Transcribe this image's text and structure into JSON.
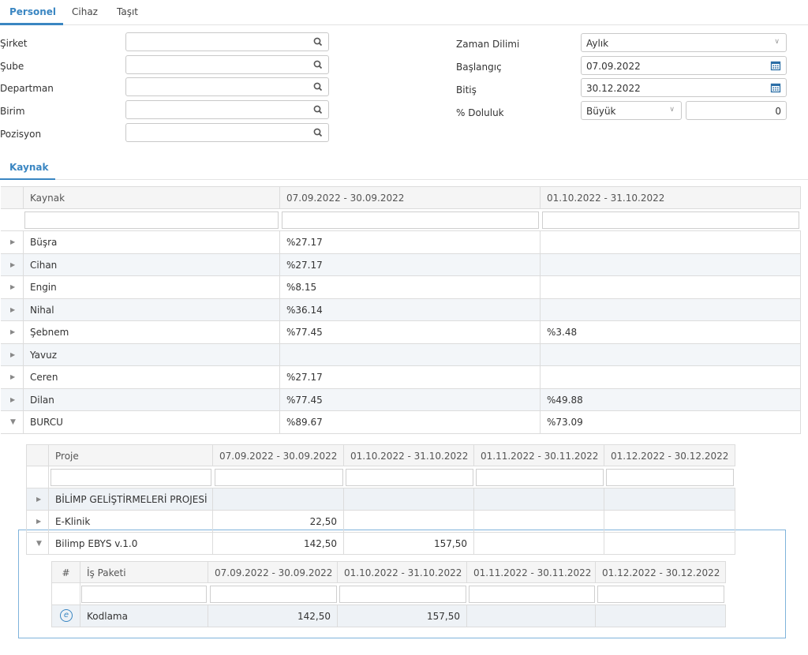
{
  "tabs": [
    {
      "label": "Personel",
      "active": true
    },
    {
      "label": "Cihaz",
      "active": false
    },
    {
      "label": "Taşıt",
      "active": false
    }
  ],
  "filters": {
    "sirket": {
      "label": "Şirket",
      "value": ""
    },
    "sube": {
      "label": "Şube",
      "value": ""
    },
    "departman": {
      "label": "Departman",
      "value": ""
    },
    "birim": {
      "label": "Birim",
      "value": ""
    },
    "pozisyon": {
      "label": "Pozisyon",
      "value": ""
    },
    "zaman_dilimi": {
      "label": "Zaman Dilimi",
      "value": "Aylık"
    },
    "baslangic": {
      "label": "Başlangıç",
      "value": "07.09.2022"
    },
    "bitis": {
      "label": "Bitiş",
      "value": "30.12.2022"
    },
    "doluluk": {
      "label": "% Doluluk",
      "operator": "Büyük",
      "value": "0"
    }
  },
  "section_tab": "Kaynak",
  "resource_grid": {
    "columns": [
      "Kaynak",
      "07.09.2022 - 30.09.2022",
      "01.10.2022 - 31.10.2022"
    ],
    "rows": [
      {
        "name": "Büşra",
        "p1": "%27.17",
        "p2": ""
      },
      {
        "name": "Cihan",
        "p1": "%27.17",
        "p2": ""
      },
      {
        "name": "Engin",
        "p1": "%8.15",
        "p2": ""
      },
      {
        "name": "Nihal",
        "p1": "%36.14",
        "p2": ""
      },
      {
        "name": "Şebnem",
        "p1": "%77.45",
        "p2": "%3.48"
      },
      {
        "name": "Yavuz",
        "p1": "",
        "p2": ""
      },
      {
        "name": "Ceren",
        "p1": "%27.17",
        "p2": ""
      },
      {
        "name": "Dilan",
        "p1": "%77.45",
        "p2": "%49.88"
      },
      {
        "name": "BURCU",
        "p1": "%89.67",
        "p2": "%73.09"
      }
    ]
  },
  "project_grid": {
    "columns": [
      "Proje",
      "07.09.2022 - 30.09.2022",
      "01.10.2022 - 31.10.2022",
      "01.11.2022 - 30.11.2022",
      "01.12.2022 - 30.12.2022"
    ],
    "rows": [
      {
        "name": "BİLİMP GELİŞTİRMELERİ PROJESİ",
        "p1": "",
        "p2": "",
        "p3": "",
        "p4": ""
      },
      {
        "name": "E-Klinik",
        "p1": "22,50",
        "p2": "",
        "p3": "",
        "p4": ""
      },
      {
        "name": "Bilimp EBYS v.1.0",
        "p1": "142,50",
        "p2": "157,50",
        "p3": "",
        "p4": ""
      }
    ]
  },
  "workpackage_grid": {
    "columns": [
      "#",
      "İş Paketi",
      "07.09.2022 - 30.09.2022",
      "01.10.2022 - 31.10.2022",
      "01.11.2022 - 30.11.2022",
      "01.12.2022 - 30.12.2022"
    ],
    "rows": [
      {
        "name": "Kodlama",
        "p1": "142,50",
        "p2": "157,50",
        "p3": "",
        "p4": ""
      }
    ]
  }
}
